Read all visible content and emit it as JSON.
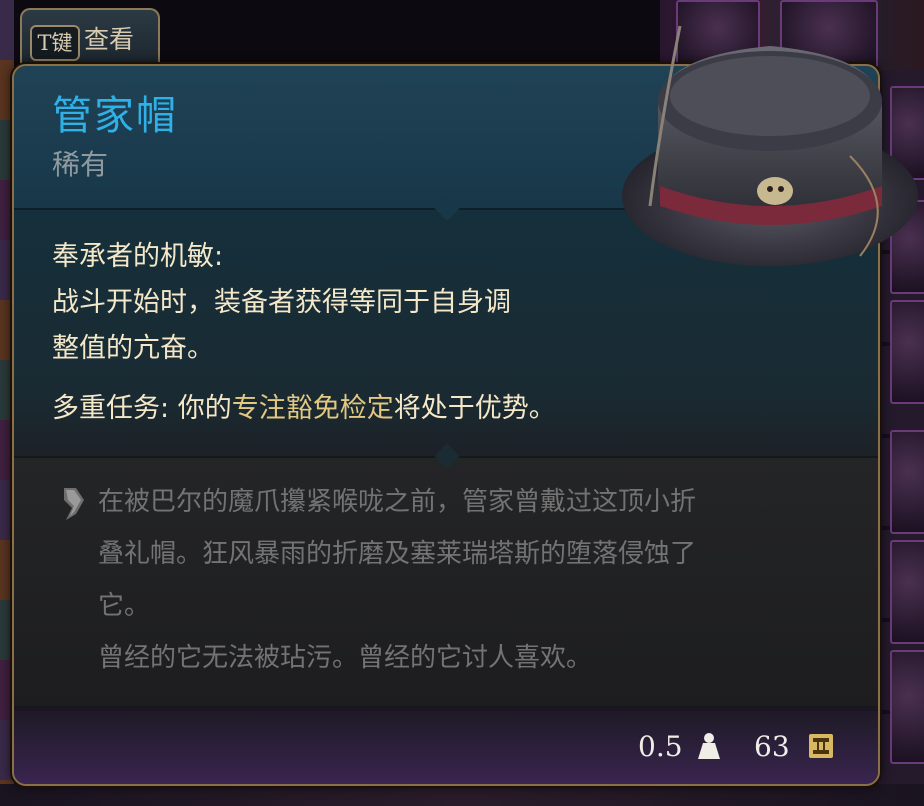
{
  "tab": {
    "key_label": "T键",
    "label": "查看"
  },
  "item": {
    "name": "管家帽",
    "rarity": "稀有"
  },
  "effects": [
    {
      "name": "奉承者的机敏:",
      "lines": [
        "战斗开始时，装备者获得等同于自身调",
        "整值的亢奋。"
      ]
    },
    {
      "name": "多重任务:",
      "pre": " 你的",
      "highlight": "专注豁免检定",
      "post": "将处于优势。"
    }
  ],
  "lore": {
    "lines": [
      "在被巴尔的魔爪攥紧喉咙之前，管家曾戴过这顶小折",
      "叠礼帽。狂风暴雨的折磨及塞莱瑞塔斯的堕落侵蚀了",
      "它。",
      "曾经的它无法被玷污。曾经的它讨人喜欢。"
    ]
  },
  "footer": {
    "weight": "0.5",
    "value": "63"
  },
  "colors": {
    "name": "#2fb0e6",
    "rarity": "#8e9aa0",
    "effect_text": "#f4e8c8",
    "keyword": "#e2c880",
    "lore_text": "#737373",
    "border": "#8a7048"
  },
  "icons": {
    "weight": "weight-icon",
    "gold": "gold-icon",
    "quote": "quote-icon"
  }
}
